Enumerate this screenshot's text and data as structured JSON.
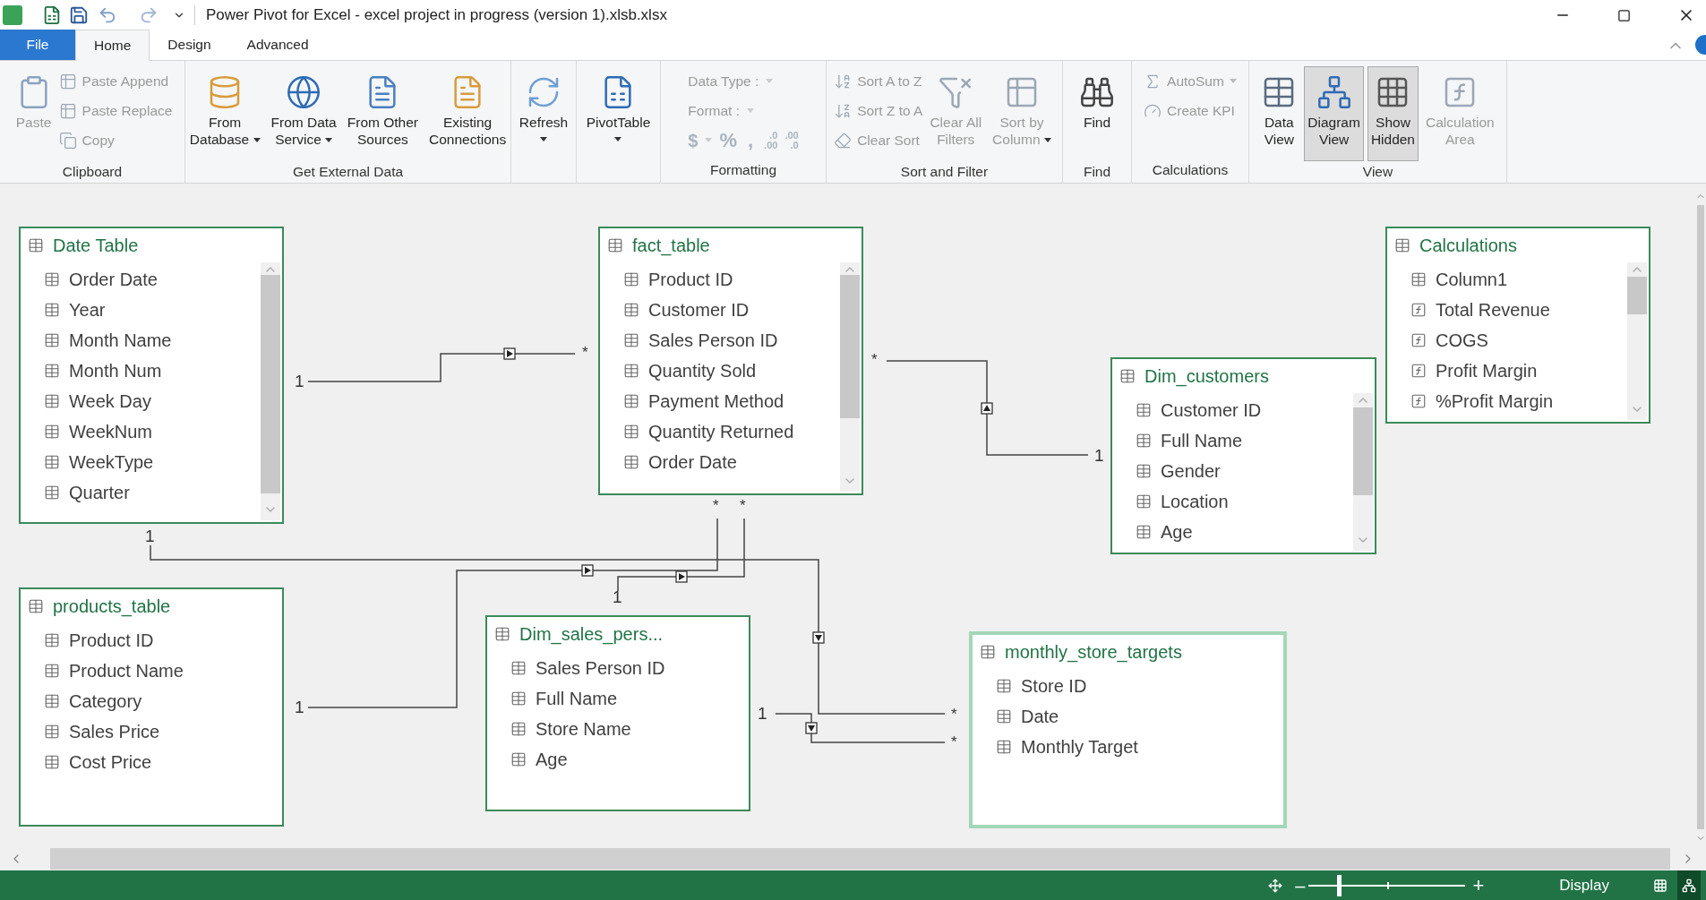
{
  "window": {
    "title": "Power Pivot for Excel - excel project in progress (version 1).xlsb.xlsx"
  },
  "menu_tabs": [
    {
      "label": "File",
      "kind": "file",
      "selected": false
    },
    {
      "label": "Home",
      "kind": "tab",
      "selected": true
    },
    {
      "label": "Design",
      "kind": "tab",
      "selected": false
    },
    {
      "label": "Advanced",
      "kind": "tab",
      "selected": false
    }
  ],
  "ribbon": {
    "groups": [
      {
        "label": "Clipboard",
        "items": [
          {
            "kind": "large",
            "lines": [
              "Paste"
            ],
            "disabled": true,
            "dropdown": false
          },
          {
            "kind": "small",
            "label": "Paste Append",
            "disabled": true,
            "dropdown": false
          },
          {
            "kind": "small",
            "label": "Paste Replace",
            "disabled": true,
            "dropdown": false
          },
          {
            "kind": "small",
            "label": "Copy",
            "disabled": true,
            "dropdown": false
          }
        ]
      },
      {
        "label": "Get External Data",
        "items": [
          {
            "kind": "large",
            "lines": [
              "From",
              "Database"
            ],
            "disabled": false,
            "dropdown": true
          },
          {
            "kind": "large",
            "lines": [
              "From Data",
              "Service"
            ],
            "disabled": false,
            "dropdown": true
          },
          {
            "kind": "large",
            "lines": [
              "From Other",
              "Sources"
            ],
            "disabled": false,
            "dropdown": false
          },
          {
            "kind": "large",
            "lines": [
              "Existing",
              "Connections"
            ],
            "disabled": false,
            "dropdown": false
          }
        ]
      },
      {
        "items": [
          {
            "kind": "large",
            "lines": [
              "Refresh"
            ],
            "disabled": false,
            "dropdown": true
          }
        ]
      },
      {
        "items": [
          {
            "kind": "large",
            "lines": [
              "PivotTable"
            ],
            "disabled": false,
            "dropdown": true
          }
        ]
      },
      {
        "label": "Formatting",
        "items": [
          {
            "kind": "select",
            "label": "Data Type :",
            "disabled": true
          },
          {
            "kind": "select",
            "label": "Format :",
            "disabled": true
          },
          {
            "kind": "format_row",
            "disabled": true,
            "currency": "$",
            "percent": "%",
            "comma": ",",
            "decimals": [
              {
                "top": ".0",
                "bottom": ".00"
              },
              {
                "top": ".00",
                "bottom": ".0"
              }
            ]
          }
        ]
      },
      {
        "label": "Sort and Filter",
        "items": [
          {
            "kind": "small",
            "label": "Sort A to Z",
            "disabled": true,
            "dropdown": false
          },
          {
            "kind": "small",
            "label": "Sort Z to A",
            "disabled": true,
            "dropdown": false
          },
          {
            "kind": "small",
            "label": "Clear Sort",
            "disabled": true,
            "dropdown": false
          },
          {
            "kind": "large",
            "lines": [
              "Clear All",
              "Filters"
            ],
            "disabled": true,
            "dropdown": false
          },
          {
            "kind": "large",
            "lines": [
              "Sort by",
              "Column"
            ],
            "disabled": true,
            "dropdown": true
          }
        ]
      },
      {
        "label": "Find",
        "items": [
          {
            "kind": "large",
            "lines": [
              "Find"
            ],
            "disabled": false,
            "dropdown": false
          }
        ]
      },
      {
        "label": "Calculations",
        "items": [
          {
            "kind": "small",
            "label": "AutoSum",
            "disabled": true,
            "dropdown": true
          },
          {
            "kind": "small",
            "label": "Create KPI",
            "disabled": true,
            "dropdown": false
          }
        ]
      },
      {
        "label": "View",
        "items": [
          {
            "kind": "large",
            "lines": [
              "Data",
              "View"
            ],
            "disabled": false,
            "dropdown": false,
            "selected": false
          },
          {
            "kind": "large",
            "lines": [
              "Diagram",
              "View"
            ],
            "disabled": false,
            "dropdown": false,
            "selected": true
          },
          {
            "kind": "large",
            "lines": [
              "Show",
              "Hidden"
            ],
            "disabled": false,
            "dropdown": false,
            "selected": true
          },
          {
            "kind": "large",
            "lines": [
              "Calculation",
              "Area"
            ],
            "disabled": true,
            "dropdown": false,
            "selected": false
          }
        ]
      }
    ]
  },
  "tables": [
    {
      "title": "Date Table",
      "selected": false,
      "fields": [
        {
          "name": "Order Date",
          "kind": "column"
        },
        {
          "name": "Year",
          "kind": "column"
        },
        {
          "name": "Month Name",
          "kind": "column"
        },
        {
          "name": "Month Num",
          "kind": "column"
        },
        {
          "name": "Week Day",
          "kind": "column"
        },
        {
          "name": "WeekNum",
          "kind": "column"
        },
        {
          "name": "WeekType",
          "kind": "column"
        },
        {
          "name": "Quarter",
          "kind": "column"
        }
      ]
    },
    {
      "title": "fact_table",
      "selected": false,
      "fields": [
        {
          "name": "Product ID",
          "kind": "column"
        },
        {
          "name": "Customer ID",
          "kind": "column"
        },
        {
          "name": "Sales Person ID",
          "kind": "column"
        },
        {
          "name": "Quantity Sold",
          "kind": "column"
        },
        {
          "name": "Payment Method",
          "kind": "column"
        },
        {
          "name": "Quantity Returned",
          "kind": "column"
        },
        {
          "name": "Order Date",
          "kind": "column"
        }
      ]
    },
    {
      "title": "Calculations",
      "selected": false,
      "fields": [
        {
          "name": "Column1",
          "kind": "column"
        },
        {
          "name": "Total Revenue",
          "kind": "measure"
        },
        {
          "name": "COGS",
          "kind": "measure"
        },
        {
          "name": "Profit Margin",
          "kind": "measure"
        },
        {
          "name": "%Profit Margin",
          "kind": "measure"
        }
      ]
    },
    {
      "title": "Dim_customers",
      "selected": false,
      "fields": [
        {
          "name": "Customer ID",
          "kind": "column"
        },
        {
          "name": "Full Name",
          "kind": "column"
        },
        {
          "name": "Gender",
          "kind": "column"
        },
        {
          "name": "Location",
          "kind": "column"
        },
        {
          "name": "Age",
          "kind": "column"
        }
      ]
    },
    {
      "title": "products_table",
      "selected": false,
      "fields": [
        {
          "name": "Product ID",
          "kind": "column"
        },
        {
          "name": "Product Name",
          "kind": "column"
        },
        {
          "name": "Category",
          "kind": "column"
        },
        {
          "name": "Sales Price",
          "kind": "column"
        },
        {
          "name": "Cost Price",
          "kind": "column"
        }
      ]
    },
    {
      "title": "Dim_sales_pers...",
      "selected": false,
      "fields": [
        {
          "name": "Sales Person ID",
          "kind": "column"
        },
        {
          "name": "Full Name",
          "kind": "column"
        },
        {
          "name": "Store Name",
          "kind": "column"
        },
        {
          "name": "Age",
          "kind": "column"
        }
      ]
    },
    {
      "title": "monthly_store_targets",
      "selected": true,
      "fields": [
        {
          "name": "Store ID",
          "kind": "column"
        },
        {
          "name": "Date",
          "kind": "column"
        },
        {
          "name": "Monthly Target",
          "kind": "column"
        }
      ]
    }
  ],
  "relationships": [
    {
      "one_label": "1",
      "many_label": "*"
    },
    {
      "one_label": "1",
      "many_label": "*"
    },
    {
      "one_label": "1",
      "many_label": "*"
    },
    {
      "one_label": "1",
      "many_label": "*"
    },
    {
      "one_label": "1",
      "many_label": "*"
    },
    {
      "one_label": "1",
      "many_label": "*"
    }
  ],
  "status_bar": {
    "zoom": {
      "minus": "–",
      "plus": "+",
      "level": 0.19
    },
    "display": "Display",
    "views": [
      {
        "selected": false
      },
      {
        "selected": true
      }
    ]
  }
}
